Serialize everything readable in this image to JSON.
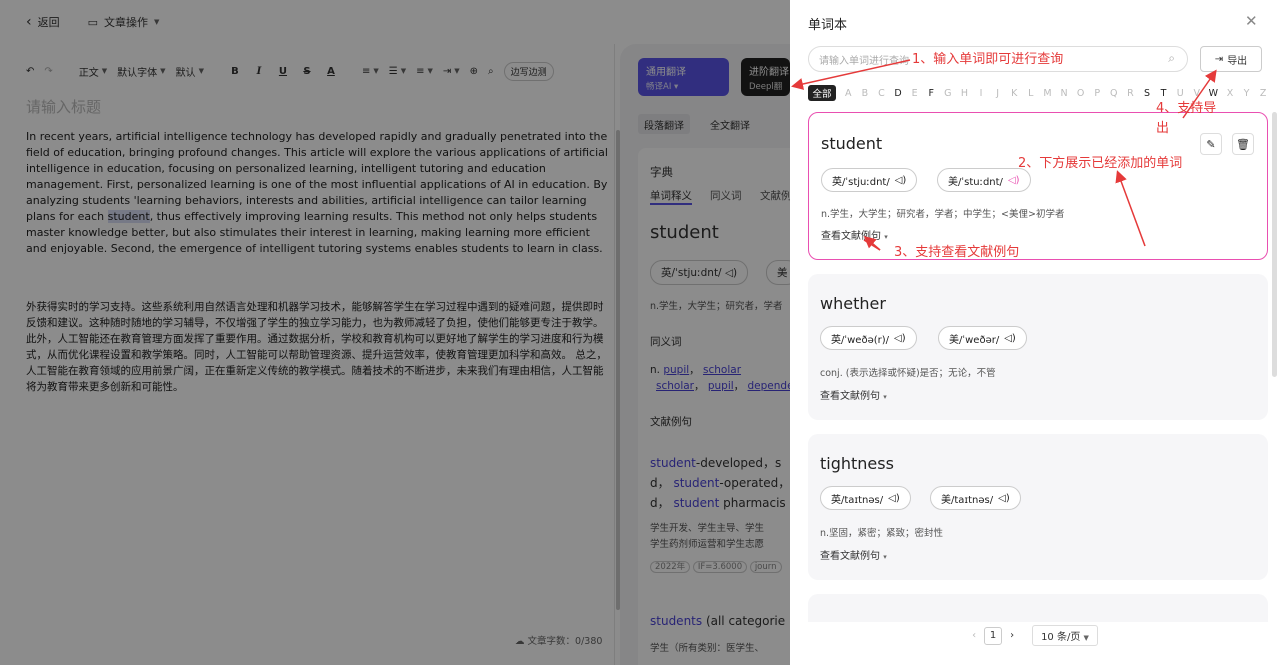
{
  "topbar": {
    "back": "返回",
    "doc_ops": "文章操作"
  },
  "toolbar": {
    "para": "正文",
    "font": "默认字体",
    "size": "默认",
    "bold": "B",
    "italic": "I",
    "underline": "U",
    "strike": "S",
    "color": "A",
    "mode": "边写边测"
  },
  "editor": {
    "title_placeholder": "请输入标题",
    "para_en_1": "In recent years, artificial intelligence technology has developed rapidly and gradually penetrated into the field of education, bringing profound changes. This article will explore the various applications of artificial intelligence in education, focusing on personalized learning, intelligent tutoring and education management. First, personalized learning is one of the most influential applications of AI in education. By analyzing students 'learning behaviors, interests and abilities, artificial intelligence can tailor learning plans for each ",
    "para_en_hl": "student",
    "para_en_2": ", thus effectively improving learning results. This method not only helps students master knowledge better, but also stimulates their interest in learning, making learning more efficient and enjoyable. Second, the emergence of intelligent tutoring systems enables students to learn in class.",
    "para_zh": "外获得实时的学习支持。这些系统利用自然语言处理和机器学习技术，能够解答学生在学习过程中遇到的疑难问题，提供即时反馈和建议。这种随时随地的学习辅导，不仅增强了学生的独立学习能力，也为教师减轻了负担，使他们能够更专注于教学。此外，人工智能还在教育管理方面发挥了重要作用。通过数据分析，学校和教育机构可以更好地了解学生的学习进度和行为模式，从而优化课程设置和教学策略。同时，人工智能可以帮助管理资源、提升运营效率，使教育管理更加科学和高效。 总之，人工智能在教育领域的应用前景广阔，正在重新定义传统的教学模式。随着技术的不断进步，未来我们有理由相信，人工智能将为教育带来更多创新和可能性。",
    "word_count": "文章字数：0/380"
  },
  "mid": {
    "card1_title": "通用翻译",
    "card1_sub": "畅译AI",
    "card2_title": "进阶翻译",
    "card2_sub": "Deepl翻",
    "tab_para": "段落翻译",
    "tab_full": "全文翻译",
    "dict": "字典",
    "tabs": [
      "单词释义",
      "同义词",
      "文献例"
    ],
    "word": "student",
    "phon_uk": "英/ˈstjuːdnt/",
    "phon_us": "美",
    "meaning": "n.学生，大学生；研究者，学者",
    "syn_title": "同义词",
    "syn_n": "n.",
    "syn1": "pupil",
    "syn2": "scholar",
    "syn3": "scholar",
    "syn4": "pupil",
    "syn5": "dependen",
    "lit_title": "文献例句",
    "ex1a": "student",
    "ex1b": "-developed，s",
    "ex1c": "d，",
    "ex1d": "student",
    "ex1e": "-operated，",
    "ex1f": "d，",
    "ex1g": "student",
    "ex1h": " pharmacis",
    "ex1_zh1": "学生开发、学生主导、学生",
    "ex1_zh2": "学生药剂师运营和学生志愿",
    "ex1_year": "2022年",
    "ex1_if": "IF=3.6000",
    "ex1_j": "journ",
    "ex2": "students",
    "ex2b": " (all categorie",
    "ex2_zh": "学生（所有类别：医学生、"
  },
  "drawer": {
    "title": "单词本",
    "search_placeholder": "请输入单词进行查询",
    "export": "导出",
    "alpha_all": "全部",
    "letters": [
      "A",
      "B",
      "C",
      "D",
      "E",
      "F",
      "G",
      "H",
      "I",
      "J",
      "K",
      "L",
      "M",
      "N",
      "O",
      "P",
      "Q",
      "R",
      "S",
      "T",
      "U",
      "V",
      "W",
      "X",
      "Y",
      "Z"
    ],
    "words": [
      {
        "word": "student",
        "uk": "英/ˈstjuːdnt/",
        "us": "美/ˈstuːdnt/",
        "meaning": "n.学生，大学生；研究者，学者；中学生；<美俚>初学者",
        "ex": "查看文献例句"
      },
      {
        "word": "whether",
        "uk": "英/ˈweðə(r)/",
        "us": "美/ˈweðər/",
        "meaning": "conj. (表示选择或怀疑)是否；无论，不管",
        "ex": "查看文献例句"
      },
      {
        "word": "tightness",
        "uk": "英/taɪtnəs/",
        "us": "美/taɪtnəs/",
        "meaning": "n.坚固，紧密；紧致；密封性",
        "ex": "查看文献例句"
      }
    ],
    "page": "1",
    "page_size": "10 条/页"
  },
  "annotations": {
    "a1": "1、输入单词即可进行查询",
    "a2": "2、下方展示已经添加的单词",
    "a3": "3、支持查看文献例句",
    "a4a": "4、支持导",
    "a4b": "出"
  }
}
